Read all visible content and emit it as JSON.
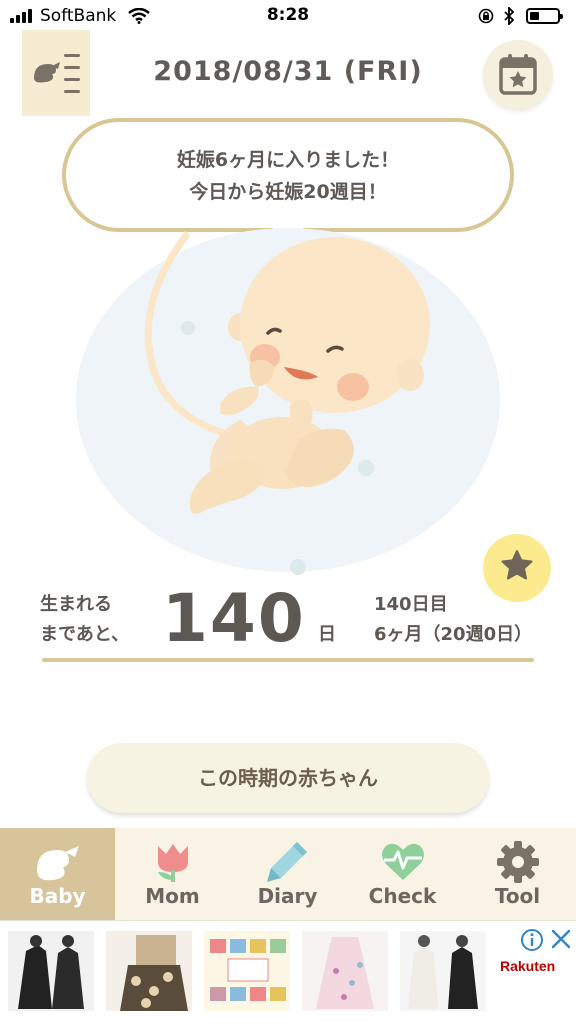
{
  "status_bar": {
    "carrier": "SoftBank",
    "time": "8:28"
  },
  "header": {
    "date": "2018/08/31 (FRI)",
    "menu_icon": "baby-list-icon",
    "calendar_icon": "calendar-star-icon"
  },
  "message": {
    "line1": "妊娠6ヶ月に入りました！",
    "line2": "今日から妊娠20週目！"
  },
  "countdown": {
    "label_line1": "生まれる",
    "label_line2": "まであと、",
    "days": "140",
    "unit": "日",
    "day_count": "140日目",
    "month_week": "6ヶ月（20週0日）"
  },
  "period_button": "この時期の赤ちゃん",
  "tabs": [
    {
      "label": "Baby",
      "icon": "bird-icon",
      "active": true
    },
    {
      "label": "Mom",
      "icon": "tulip-icon",
      "active": false
    },
    {
      "label": "Diary",
      "icon": "pencil-icon",
      "active": false
    },
    {
      "label": "Check",
      "icon": "heart-pulse-icon",
      "active": false
    },
    {
      "label": "Tool",
      "icon": "gear-icon",
      "active": false
    }
  ],
  "ad": {
    "brand": "Rakuten"
  },
  "colors": {
    "accent_gold": "#d9c695",
    "tab_active": "#d8c49a",
    "tab_bg": "#f8f3e4",
    "star_bg": "#fbeb8e"
  }
}
